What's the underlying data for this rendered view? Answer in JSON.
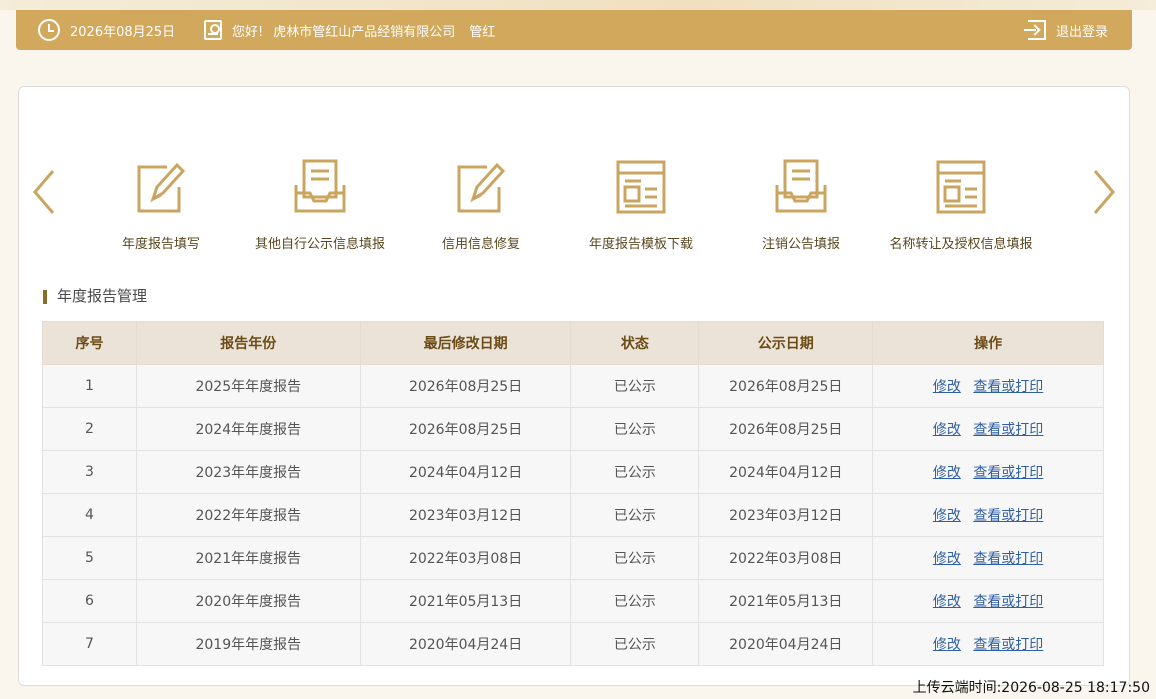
{
  "header": {
    "date": "2026年08月25日",
    "greeting": "您好!",
    "company": "虎林市管红山产品经销有限公司",
    "user": "管红",
    "logout_label": "退出登录"
  },
  "nav": {
    "items": [
      {
        "label": "年度报告填写",
        "icon": "edit-form-icon"
      },
      {
        "label": "其他自行公示信息填报",
        "icon": "inbox-document-icon"
      },
      {
        "label": "信用信息修复",
        "icon": "edit-form-icon"
      },
      {
        "label": "年度报告模板下载",
        "icon": "template-window-icon"
      },
      {
        "label": "注销公告填报",
        "icon": "inbox-document-icon"
      },
      {
        "label": "名称转让及授权信息填报",
        "icon": "template-window-icon"
      }
    ]
  },
  "section": {
    "title": "年度报告管理"
  },
  "table": {
    "headers": [
      "序号",
      "报告年份",
      "最后修改日期",
      "状态",
      "公示日期",
      "操作"
    ],
    "action_edit": "修改",
    "action_view": "查看或打印",
    "rows": [
      {
        "no": "1",
        "year": "2025年年度报告",
        "modified": "2026年08月25日",
        "status": "已公示",
        "published": "2026年08月25日"
      },
      {
        "no": "2",
        "year": "2024年年度报告",
        "modified": "2026年08月25日",
        "status": "已公示",
        "published": "2026年08月25日"
      },
      {
        "no": "3",
        "year": "2023年年度报告",
        "modified": "2024年04月12日",
        "status": "已公示",
        "published": "2024年04月12日"
      },
      {
        "no": "4",
        "year": "2022年年度报告",
        "modified": "2023年03月12日",
        "status": "已公示",
        "published": "2023年03月12日"
      },
      {
        "no": "5",
        "year": "2021年年度报告",
        "modified": "2022年03月08日",
        "status": "已公示",
        "published": "2022年03月08日"
      },
      {
        "no": "6",
        "year": "2020年年度报告",
        "modified": "2021年05月13日",
        "status": "已公示",
        "published": "2021年05月13日"
      },
      {
        "no": "7",
        "year": "2019年年度报告",
        "modified": "2020年04月24日",
        "status": "已公示",
        "published": "2020年04月24日"
      }
    ]
  },
  "footer": {
    "upload_time": "上传云端时间:2026-08-25 18:17:50"
  },
  "colors": {
    "header_bg": "#d1a85c",
    "accent": "#c9a560",
    "link": "#2f5fa5"
  }
}
